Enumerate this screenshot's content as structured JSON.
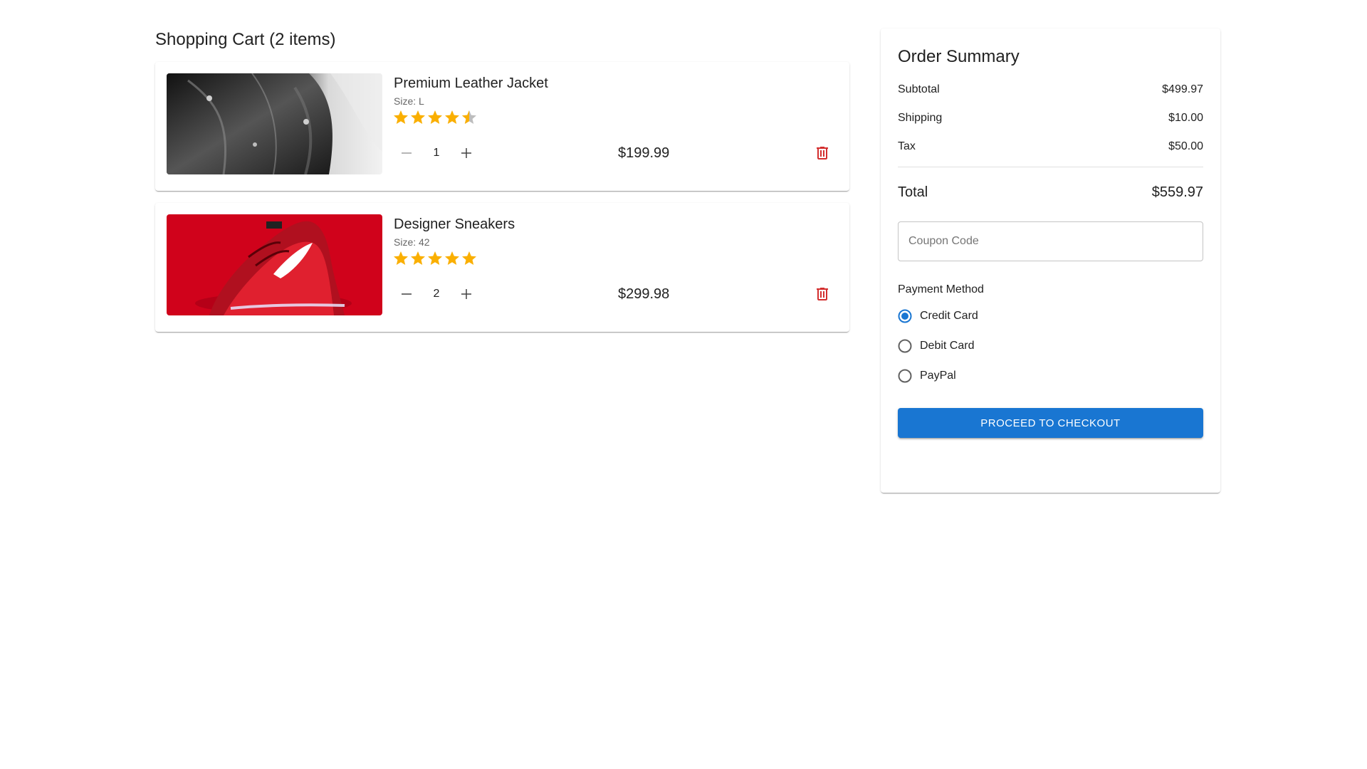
{
  "cart": {
    "title": "Shopping Cart (2 items)",
    "items": [
      {
        "name": "Premium Leather Jacket",
        "size": "Size: L",
        "rating": 4.5,
        "rating_max": 5,
        "quantity": "1",
        "price": "$199.99",
        "image": "leather-jacket-photo"
      },
      {
        "name": "Designer Sneakers",
        "size": "Size: 42",
        "rating": 5,
        "rating_max": 5,
        "quantity": "2",
        "price": "$299.98",
        "image": "red-sneakers-photo"
      }
    ]
  },
  "summary": {
    "title": "Order Summary",
    "subtotal_label": "Subtotal",
    "subtotal_value": "$499.97",
    "shipping_label": "Shipping",
    "shipping_value": "$10.00",
    "tax_label": "Tax",
    "tax_value": "$50.00",
    "total_label": "Total",
    "total_value": "$559.97",
    "coupon_placeholder": "Coupon Code",
    "coupon_value": "",
    "payment_label": "Payment Method",
    "payment_options": [
      {
        "label": "Credit Card",
        "selected": true
      },
      {
        "label": "Debit Card",
        "selected": false
      },
      {
        "label": "PayPal",
        "selected": false
      }
    ],
    "checkout_label": "PROCEED TO CHECKOUT"
  },
  "icons": {
    "star": "star-icon",
    "half_star": "star-half-icon",
    "minus": "minus-icon",
    "plus": "plus-icon",
    "delete": "trash-icon"
  },
  "colors": {
    "primary": "#1976d2",
    "star": "#faaf00",
    "star_empty": "#bdbdbd",
    "delete": "#d32f2f",
    "text": "#212121",
    "muted": "#666666"
  }
}
